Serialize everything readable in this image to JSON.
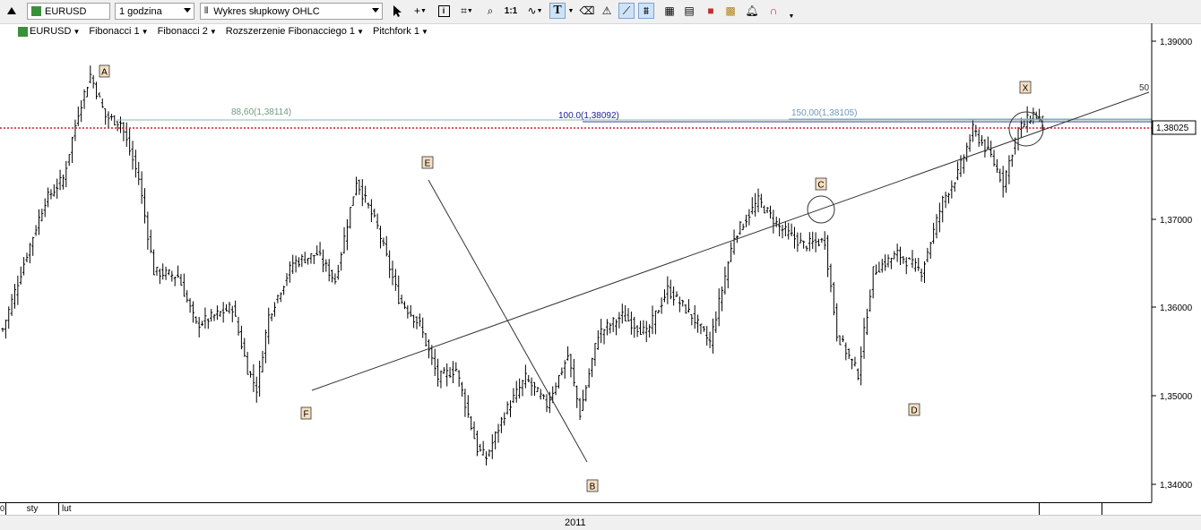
{
  "toolbar": {
    "symbol": "EURUSD",
    "timeframe": "1 godzina",
    "chart_type": "Wykres słupkowy OHLC",
    "ratio_label": "1:1",
    "text_tool": "T"
  },
  "tabs": [
    {
      "label": "EURUSD"
    },
    {
      "label": "Fibonacci 1"
    },
    {
      "label": "Fibonacci 2"
    },
    {
      "label": "Rozszerzenie Fibonacciego 1"
    },
    {
      "label": "Pitchfork 1"
    }
  ],
  "price_axis": {
    "ticks": [
      "1,39000",
      "1,38025",
      "1,37000",
      "1,36000",
      "1,35000",
      "1,34000"
    ],
    "current_price": "1,38025"
  },
  "time_axis": {
    "months": [
      "sty",
      "lut"
    ],
    "year": "2011",
    "left_marker": "0"
  },
  "annotations": {
    "wave_labels": [
      "A",
      "E",
      "F",
      "B",
      "C",
      "D",
      "X"
    ],
    "fib_labels": [
      "88,60(1,38114)",
      "100.0(1,38092)",
      "150,00(1,38105)"
    ],
    "pitchfork_label": "50"
  },
  "chart_data": {
    "type": "ohlc",
    "symbol": "EURUSD",
    "ylim": [
      1.3365,
      1.3945
    ],
    "yticks": [
      1.34,
      1.35,
      1.36,
      1.37,
      1.38,
      1.39
    ],
    "current_price": 1.38025,
    "fib_levels": [
      1.38114,
      1.38092,
      1.38105
    ],
    "pivots": [
      {
        "label": "A",
        "price": 1.3862
      },
      {
        "label": "F",
        "price": 1.3508
      },
      {
        "label": "E",
        "price": 1.3743
      },
      {
        "label": "B",
        "price": 1.3428
      },
      {
        "label": "C",
        "price": 1.3724
      },
      {
        "label": "D",
        "price": 1.3525
      },
      {
        "label": "X",
        "price": 1.3818
      }
    ],
    "close_path": [
      {
        "i": 0,
        "p": 1.3575
      },
      {
        "i": 8,
        "p": 1.366
      },
      {
        "i": 14,
        "p": 1.372
      },
      {
        "i": 20,
        "p": 1.3745
      },
      {
        "i": 25,
        "p": 1.382
      },
      {
        "i": 29,
        "p": 1.3862
      },
      {
        "i": 34,
        "p": 1.3815
      },
      {
        "i": 39,
        "p": 1.3808
      },
      {
        "i": 45,
        "p": 1.3745
      },
      {
        "i": 50,
        "p": 1.364
      },
      {
        "i": 58,
        "p": 1.3635
      },
      {
        "i": 64,
        "p": 1.358
      },
      {
        "i": 70,
        "p": 1.359
      },
      {
        "i": 76,
        "p": 1.36
      },
      {
        "i": 81,
        "p": 1.353
      },
      {
        "i": 84,
        "p": 1.3508
      },
      {
        "i": 88,
        "p": 1.359
      },
      {
        "i": 96,
        "p": 1.365
      },
      {
        "i": 104,
        "p": 1.366
      },
      {
        "i": 110,
        "p": 1.363
      },
      {
        "i": 117,
        "p": 1.3743
      },
      {
        "i": 124,
        "p": 1.369
      },
      {
        "i": 131,
        "p": 1.361
      },
      {
        "i": 138,
        "p": 1.358
      },
      {
        "i": 144,
        "p": 1.352
      },
      {
        "i": 150,
        "p": 1.353
      },
      {
        "i": 157,
        "p": 1.344
      },
      {
        "i": 160,
        "p": 1.343
      },
      {
        "i": 166,
        "p": 1.348
      },
      {
        "i": 173,
        "p": 1.352
      },
      {
        "i": 180,
        "p": 1.349
      },
      {
        "i": 187,
        "p": 1.3545
      },
      {
        "i": 191,
        "p": 1.348
      },
      {
        "i": 197,
        "p": 1.357
      },
      {
        "i": 205,
        "p": 1.359
      },
      {
        "i": 213,
        "p": 1.357
      },
      {
        "i": 220,
        "p": 1.362
      },
      {
        "i": 228,
        "p": 1.359
      },
      {
        "i": 234,
        "p": 1.356
      },
      {
        "i": 242,
        "p": 1.368
      },
      {
        "i": 250,
        "p": 1.372
      },
      {
        "i": 257,
        "p": 1.369
      },
      {
        "i": 265,
        "p": 1.367
      },
      {
        "i": 272,
        "p": 1.3675
      },
      {
        "i": 276,
        "p": 1.357
      },
      {
        "i": 283,
        "p": 1.3525
      },
      {
        "i": 288,
        "p": 1.364
      },
      {
        "i": 296,
        "p": 1.366
      },
      {
        "i": 304,
        "p": 1.364
      },
      {
        "i": 311,
        "p": 1.372
      },
      {
        "i": 316,
        "p": 1.375
      },
      {
        "i": 321,
        "p": 1.38
      },
      {
        "i": 327,
        "p": 1.377
      },
      {
        "i": 331,
        "p": 1.374
      },
      {
        "i": 336,
        "p": 1.38
      },
      {
        "i": 341,
        "p": 1.3818
      },
      {
        "i": 344,
        "p": 1.381
      }
    ]
  }
}
